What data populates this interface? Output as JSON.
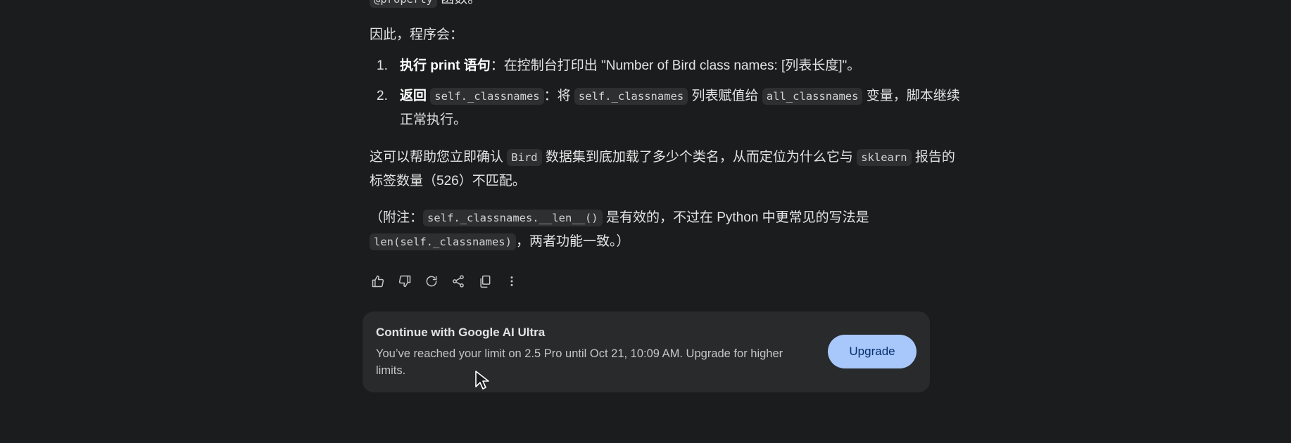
{
  "response": {
    "partial_top": {
      "code": "@property",
      "text": " 函数。"
    },
    "intro": "因此，程序会：",
    "list": [
      {
        "number": "1.",
        "bold": "执行 print 语句",
        "text": "：在控制台打印出 \"Number of Bird class names: [列表长度]\"。"
      },
      {
        "number": "2.",
        "bold": "返回",
        "code1": "self._classnames",
        "text1": "：将",
        "code2": "self._classnames",
        "text2": "列表赋值给",
        "code3": "all_classnames",
        "text3": "变量，脚本继续正常执行。"
      }
    ],
    "para1": {
      "t1": "这可以帮助您立即确认",
      "code1": "Bird",
      "t2": "数据集到底加载了多少个类名，从而定位为什么它与",
      "code2": "sklearn",
      "t3": "报告的标签数量（526）不匹配。"
    },
    "para2": {
      "t1": "（附注：",
      "code1": "self._classnames.__len__()",
      "t2": "是有效的，不过在 Python 中更常见的写法是",
      "code2": "len(self._classnames)",
      "t3": "，两者功能一致。）"
    }
  },
  "actions": [
    {
      "icon": "thumb-up-icon"
    },
    {
      "icon": "thumb-down-icon"
    },
    {
      "icon": "refresh-icon"
    },
    {
      "icon": "share-icon"
    },
    {
      "icon": "copy-icon"
    },
    {
      "icon": "more-vert-icon"
    }
  ],
  "upgrade_card": {
    "title": "Continue with Google AI Ultra",
    "message": "You’ve reached your limit on 2.5 Pro until Oct 21, 10:09 AM. Upgrade for higher limits.",
    "button_label": "Upgrade"
  },
  "colors": {
    "background": "#1b1c1d",
    "card_background": "#282a2c",
    "button_background": "#a8c7fa",
    "button_text": "#062e6f"
  }
}
